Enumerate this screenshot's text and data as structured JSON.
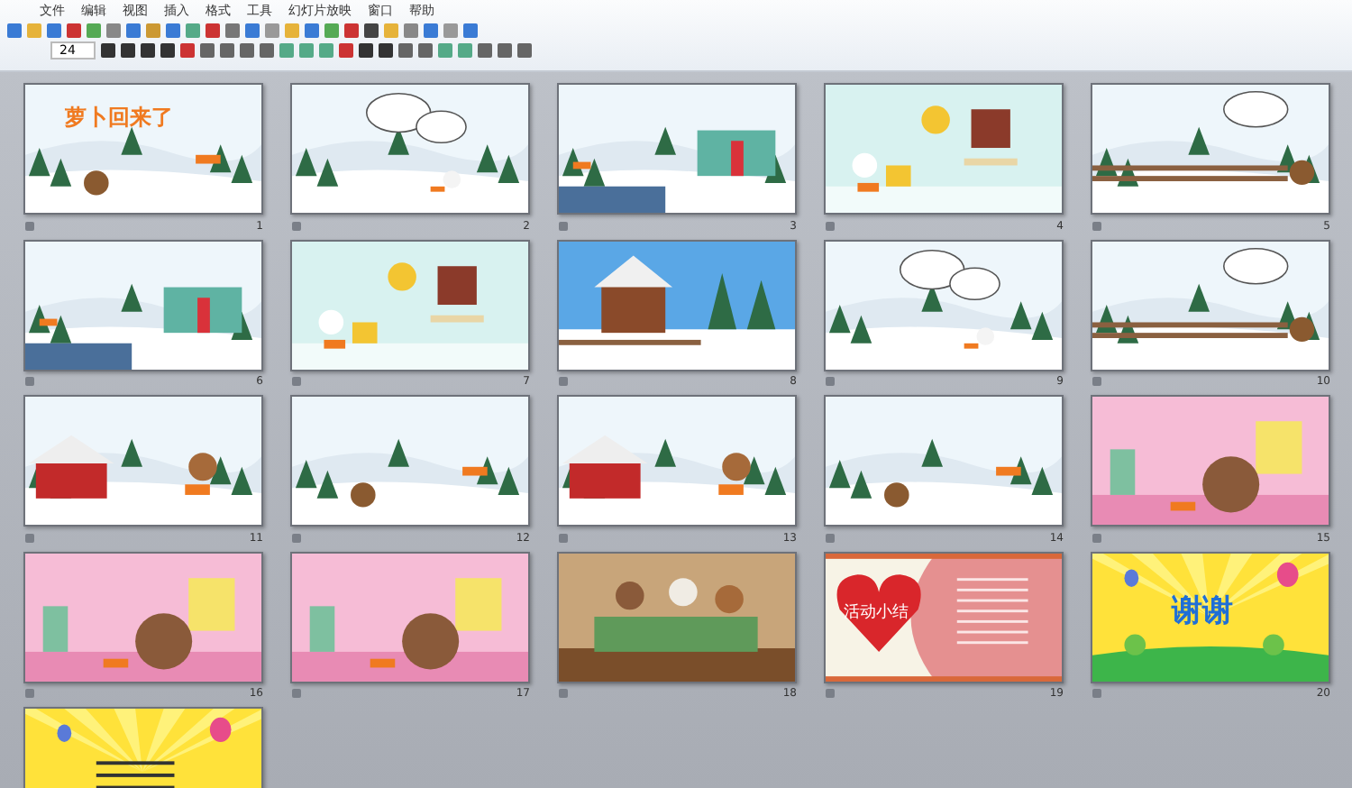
{
  "menu": [
    "文件",
    "编辑",
    "视图",
    "插入",
    "格式",
    "工具",
    "幻灯片放映",
    "窗口",
    "帮助"
  ],
  "toolbar": {
    "font_size": "24"
  },
  "slides": [
    {
      "number": "1",
      "kind": "snow",
      "title": "萝卜回来了"
    },
    {
      "number": "2",
      "kind": "bubble"
    },
    {
      "number": "3",
      "kind": "house"
    },
    {
      "number": "4",
      "kind": "room"
    },
    {
      "number": "5",
      "kind": "fence"
    },
    {
      "number": "6",
      "kind": "house"
    },
    {
      "number": "7",
      "kind": "room"
    },
    {
      "number": "8",
      "kind": "cabin"
    },
    {
      "number": "9",
      "kind": "bubble"
    },
    {
      "number": "10",
      "kind": "fence"
    },
    {
      "number": "11",
      "kind": "barn"
    },
    {
      "number": "12",
      "kind": "snow"
    },
    {
      "number": "13",
      "kind": "barn"
    },
    {
      "number": "14",
      "kind": "snow"
    },
    {
      "number": "15",
      "kind": "nursery"
    },
    {
      "number": "16",
      "kind": "nursery"
    },
    {
      "number": "17",
      "kind": "nursery"
    },
    {
      "number": "18",
      "kind": "table"
    },
    {
      "number": "19",
      "kind": "heart",
      "title": "活动小结"
    },
    {
      "number": "20",
      "kind": "thanks",
      "title": "谢谢"
    },
    {
      "kind": "yellow"
    }
  ]
}
